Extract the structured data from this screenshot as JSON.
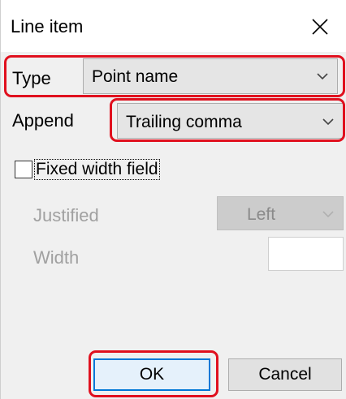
{
  "dialog": {
    "title": "Line item",
    "close_icon": "close-icon"
  },
  "type_field": {
    "label": "Type",
    "value": "Point name",
    "icon": "chevron-down-icon"
  },
  "append_field": {
    "label": "Append",
    "value": "Trailing comma",
    "icon": "chevron-down-icon"
  },
  "fixed_width": {
    "label": "Fixed width field",
    "checked": false
  },
  "justified_field": {
    "label": "Justified",
    "value": "Left",
    "icon": "chevron-down-icon"
  },
  "width_field": {
    "label": "Width",
    "value": ""
  },
  "buttons": {
    "ok_label": "OK",
    "cancel_label": "Cancel"
  },
  "colors": {
    "highlight": "#e0101e",
    "dialog_bg": "#f0f0f0",
    "disabled_text": "#a0a0a0",
    "default_button_border": "#0078d7"
  }
}
